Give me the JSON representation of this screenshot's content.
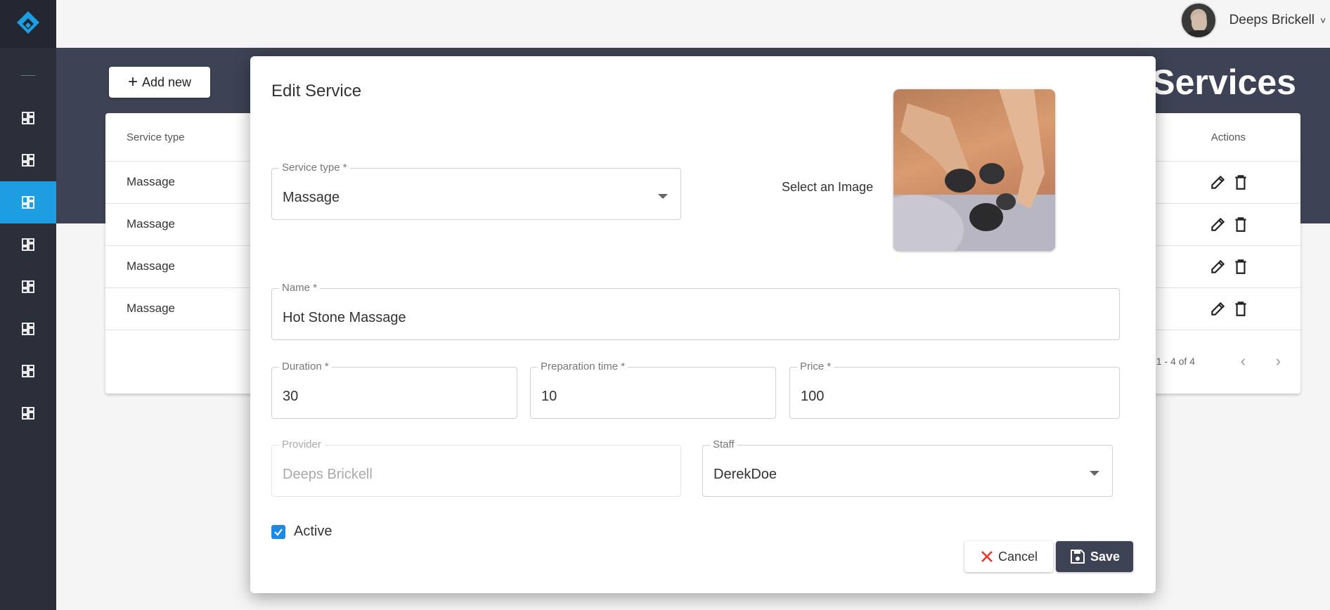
{
  "header": {
    "user_name": "Deeps Brickell",
    "user_caret": "˅"
  },
  "sidebar": {
    "active_color": "#1e9de3",
    "items": [
      {
        "icon": "dashboard-icon",
        "active": false
      },
      {
        "icon": "dashboard-icon",
        "active": false
      },
      {
        "icon": "dashboard-icon",
        "active": true
      },
      {
        "icon": "dashboard-icon",
        "active": false
      },
      {
        "icon": "dashboard-icon",
        "active": false
      },
      {
        "icon": "dashboard-icon",
        "active": false
      },
      {
        "icon": "dashboard-icon",
        "active": false
      },
      {
        "icon": "dashboard-icon",
        "active": false
      }
    ]
  },
  "page": {
    "title": "Services",
    "add_new_label": "Add new"
  },
  "table": {
    "columns": [
      "Service type",
      "Actions"
    ],
    "rows": [
      {
        "service_type": "Massage"
      },
      {
        "service_type": "Massage"
      },
      {
        "service_type": "Massage"
      },
      {
        "service_type": "Massage"
      }
    ],
    "pagination_range": "1 - 4 of 4"
  },
  "modal": {
    "title": "Edit Service",
    "service_type": {
      "label": "Service type *",
      "value": "Massage"
    },
    "image_label": "Select an Image",
    "image_icon": "hot-stone-massage-photo",
    "name": {
      "label": "Name *",
      "value": "Hot Stone Massage"
    },
    "duration": {
      "label": "Duration *",
      "value": "30"
    },
    "preparation_time": {
      "label": "Preparation time *",
      "value": "10"
    },
    "price": {
      "label": "Price *",
      "value": "100"
    },
    "provider": {
      "label": "Provider",
      "value": "Deeps  Brickell"
    },
    "staff": {
      "label": "Staff",
      "value": "DerekDoe"
    },
    "active": {
      "label": "Active",
      "checked": true
    },
    "cancel_label": "Cancel",
    "save_label": "Save"
  },
  "colors": {
    "sidebar": "#2b2f3a",
    "band": "#3d4254",
    "accent": "#1e9de3",
    "cancel_icon": "#e53935"
  }
}
